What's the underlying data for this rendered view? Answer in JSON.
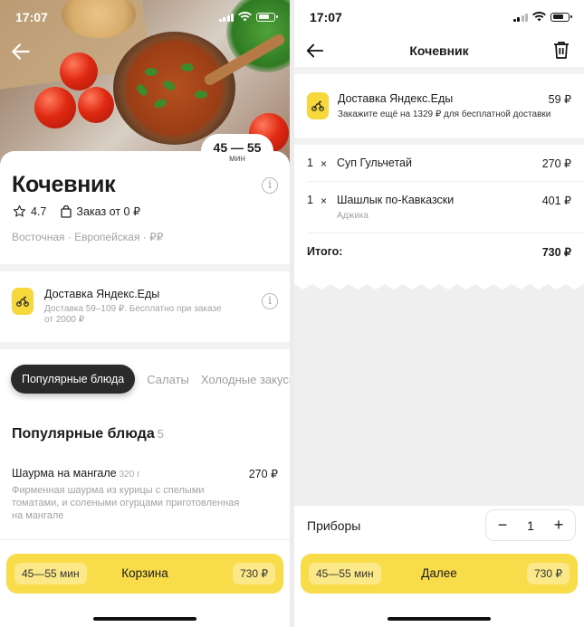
{
  "left": {
    "status_time": "17:07",
    "hero_time": "45 — 55",
    "hero_time_unit": "мин",
    "restaurant_name": "Кочевник",
    "rating": "4.7",
    "min_order": "Заказ от 0 ₽",
    "cuisine": "Восточная · Европейская · ₽₽",
    "delivery": {
      "title": "Доставка Яндекс.Еды",
      "subtitle_line1": "Доставка 59–109 ₽. Бесплатно при заказе",
      "subtitle_line2": "от 2000 ₽"
    },
    "tabs": {
      "active": "Популярные блюда",
      "items": [
        "Салаты",
        "Холодные закуски"
      ]
    },
    "section": {
      "title": "Популярные блюда",
      "count": "5"
    },
    "dish": {
      "name": "Шаурма на мангале",
      "weight": "320 г",
      "price": "270 ₽",
      "description": "Фирменная шаурма из курицы с спелыми томатами, и солеными огурцами приготовленная на мангале"
    },
    "bottom_bar": {
      "time": "45—55 мин",
      "label": "Корзина",
      "total": "730 ₽"
    }
  },
  "right": {
    "status_time": "17:07",
    "title": "Кочевник",
    "delivery": {
      "title": "Доставка Яндекс.Еды",
      "price": "59 ₽",
      "hint": "Закажите ещё на 1329 ₽ для бесплатной доставки"
    },
    "items": [
      {
        "qty": "1",
        "x": "×",
        "name": "Суп Гульчетай",
        "price": "270 ₽",
        "note": ""
      },
      {
        "qty": "1",
        "x": "×",
        "name": "Шашлык по-Кавказски",
        "price": "401 ₽",
        "note": "Аджика"
      }
    ],
    "total_label": "Итого:",
    "total_value": "730 ₽",
    "cutlery_label": "Приборы",
    "cutlery_qty": "1",
    "stepper_minus": "−",
    "stepper_plus": "+",
    "bottom_bar": {
      "time": "45—55 мин",
      "label": "Далее",
      "total": "730 ₽"
    }
  },
  "colors": {
    "accent_yellow": "#f9dc4a",
    "text_primary": "#1b1b1b",
    "text_secondary": "#a3a3a3"
  }
}
